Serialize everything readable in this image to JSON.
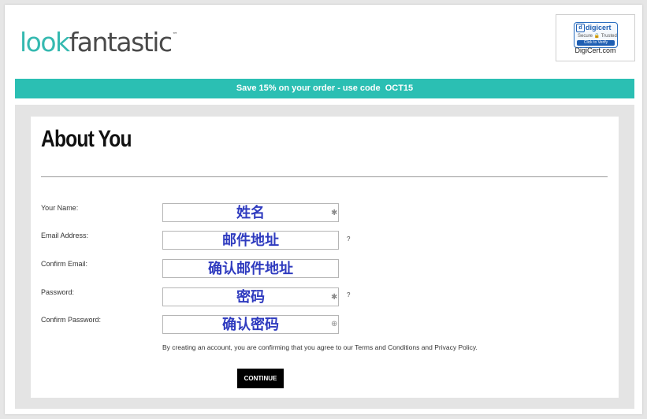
{
  "header": {
    "logo_part1": "look",
    "logo_part2": "fantastic",
    "logo_tm": "™",
    "digicert_brand": "digicert",
    "digicert_brand_initial": "d",
    "digicert_seal_text": "Secure 🔒 Trusted",
    "digicert_seal_button": "Click to Verify",
    "digicert_site": "DigiCert.com"
  },
  "promo": {
    "text": "Save 15% on your order - use code  OCT15"
  },
  "form": {
    "title": "About You",
    "fields": [
      {
        "label": "Your Name:",
        "value": "姓名",
        "required_mark": "✱",
        "help": ""
      },
      {
        "label": "Email Address:",
        "value": "邮件地址",
        "required_mark": "",
        "help": "?"
      },
      {
        "label": "Confirm Email:",
        "value": "确认邮件地址",
        "required_mark": "",
        "help": ""
      },
      {
        "label": "Password:",
        "value": "密码",
        "required_mark": "✱",
        "help": "?"
      },
      {
        "label": "Confirm Password:",
        "value": "确认密码",
        "required_mark": "⊕",
        "help": ""
      }
    ],
    "terms": "By creating an account, you are confirming that you agree to our Terms and Conditions and Privacy Policy.",
    "continue_label": "CONTINUE"
  }
}
